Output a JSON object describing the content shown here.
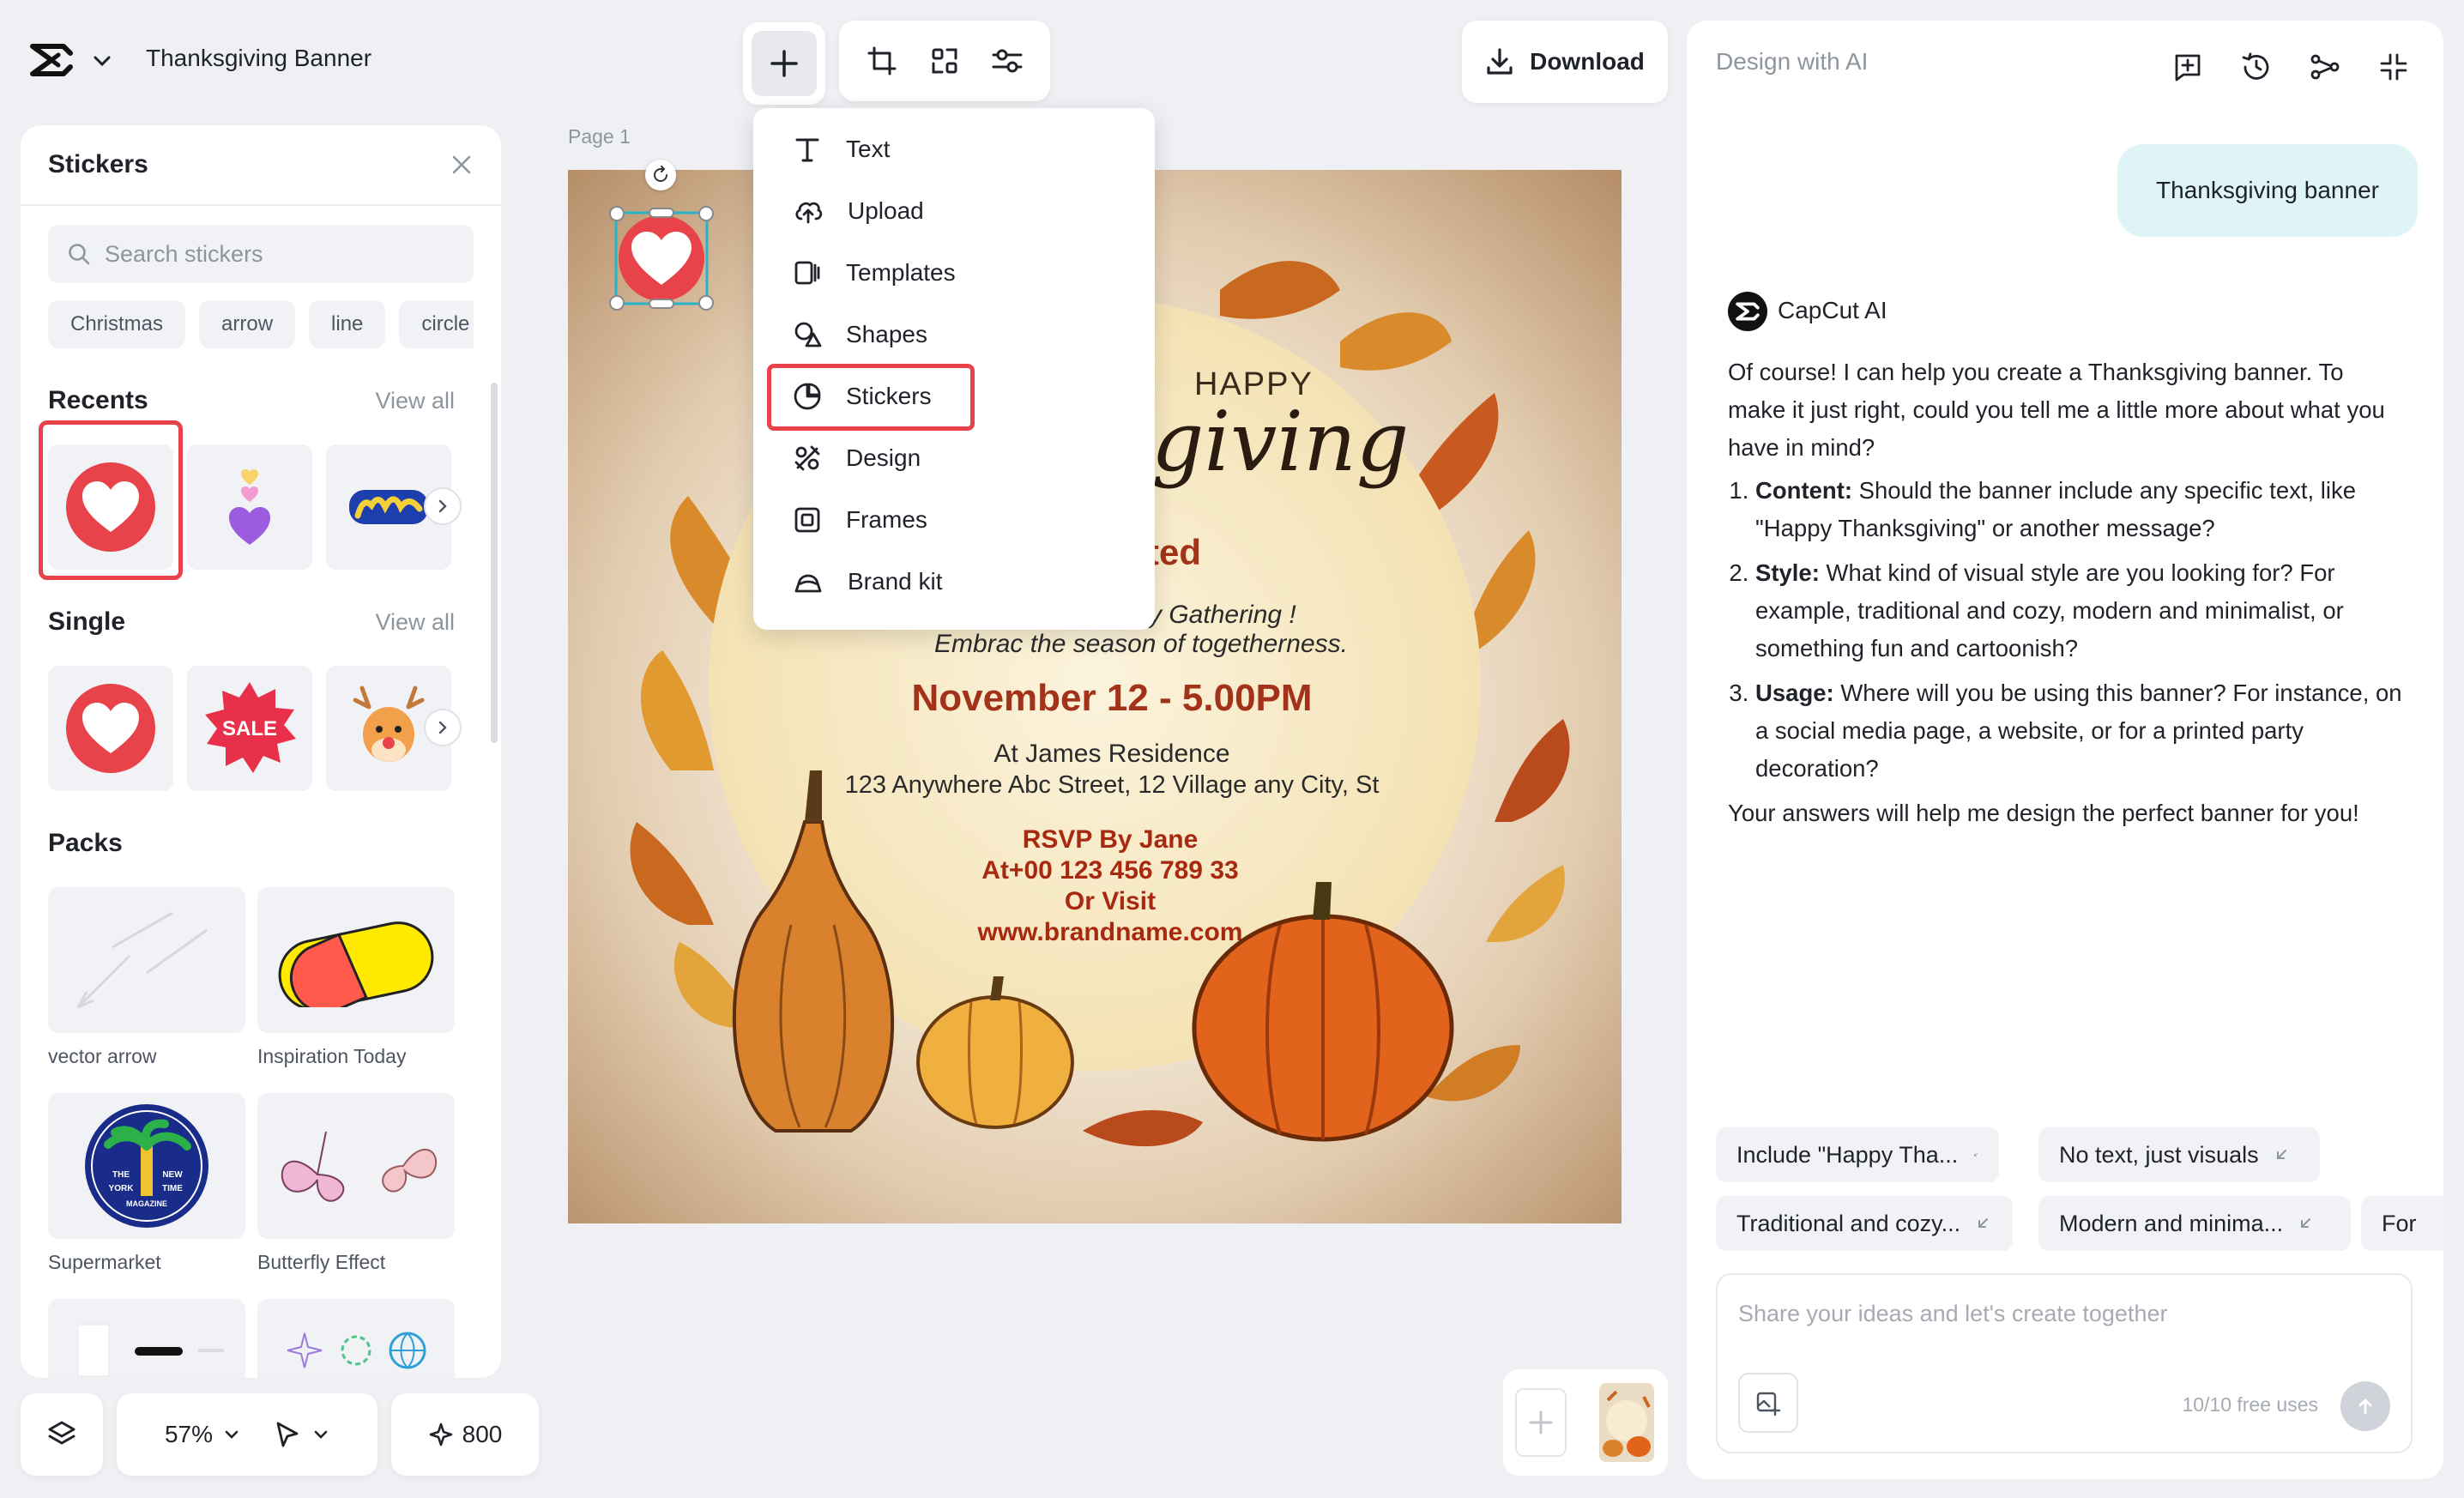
{
  "header": {
    "doc_title": "Thanksgiving Banner",
    "download_label": "Download"
  },
  "add_menu": {
    "items": [
      {
        "label": "Text",
        "icon": "text-icon"
      },
      {
        "label": "Upload",
        "icon": "upload-cloud-icon"
      },
      {
        "label": "Templates",
        "icon": "templates-icon"
      },
      {
        "label": "Shapes",
        "icon": "shapes-icon"
      },
      {
        "label": "Stickers",
        "icon": "sticker-icon"
      },
      {
        "label": "Design",
        "icon": "design-icon"
      },
      {
        "label": "Frames",
        "icon": "frames-icon"
      },
      {
        "label": "Brand kit",
        "icon": "brand-kit-icon"
      }
    ],
    "highlighted": "Stickers"
  },
  "stickers_panel": {
    "title": "Stickers",
    "search_placeholder": "Search stickers",
    "chips": [
      "Christmas",
      "arrow",
      "line",
      "circle"
    ],
    "recents_title": "Recents",
    "single_title": "Single",
    "packs_title": "Packs",
    "view_all": "View all",
    "sale_text": "SALE",
    "packs": [
      {
        "label": "vector arrow"
      },
      {
        "label": "Inspiration Today"
      },
      {
        "label": "Supermarket"
      },
      {
        "label": "Butterfly Effect"
      }
    ],
    "magazine_words": [
      "THE",
      "NEW",
      "YORK",
      "TIME",
      "MAGAZINE"
    ]
  },
  "canvas": {
    "page_label": "Page 1",
    "happy": "HAPPY",
    "script_title": "giving",
    "invited": "vited",
    "gathering": "amily Gathering !",
    "embrace": "Embrac the season of togetherness.",
    "date": "November 12 - 5.00PM",
    "place": "At James Residence",
    "address": "123 Anywhere Abc Street, 12 Village any City, St",
    "rsvp": "RSVP By Jane",
    "phone": "At+00 123 456 789 33",
    "or_visit": "Or Visit",
    "website": "www.brandname.com"
  },
  "bottom_controls": {
    "zoom": "57%",
    "credits": "800"
  },
  "ai_panel": {
    "title": "Design with AI",
    "user_message": "Thanksgiving banner",
    "ai_name": "CapCut AI",
    "intro": "Of course! I can help you create a Thanksgiving banner. To make it just right, could you tell me a little more about what you have in mind?",
    "questions": [
      {
        "label": "Content:",
        "text": " Should the banner include any specific text, like \"Happy Thanksgiving\" or another message?"
      },
      {
        "label": "Style:",
        "text": " What kind of visual style are you looking for? For example, traditional and cozy, modern and minimalist, or something fun and cartoonish?"
      },
      {
        "label": "Usage:",
        "text": " Where will you be using this banner? For instance, on a social media page, a website, or for a printed party decoration?"
      }
    ],
    "outro": "Your answers will help me design the perfect banner for you!",
    "suggestions": [
      "Include \"Happy Tha...",
      "No text, just visuals",
      "Traditional and cozy...",
      "Modern and minima...",
      "For"
    ],
    "input_placeholder": "Share your ideas and let's create together",
    "free_uses": "10/10 free uses"
  },
  "colors": {
    "accent_red": "#e8424a",
    "user_bubble": "#dff4f6",
    "date_text": "#a2321a",
    "rsvp_text": "#a8290f"
  }
}
